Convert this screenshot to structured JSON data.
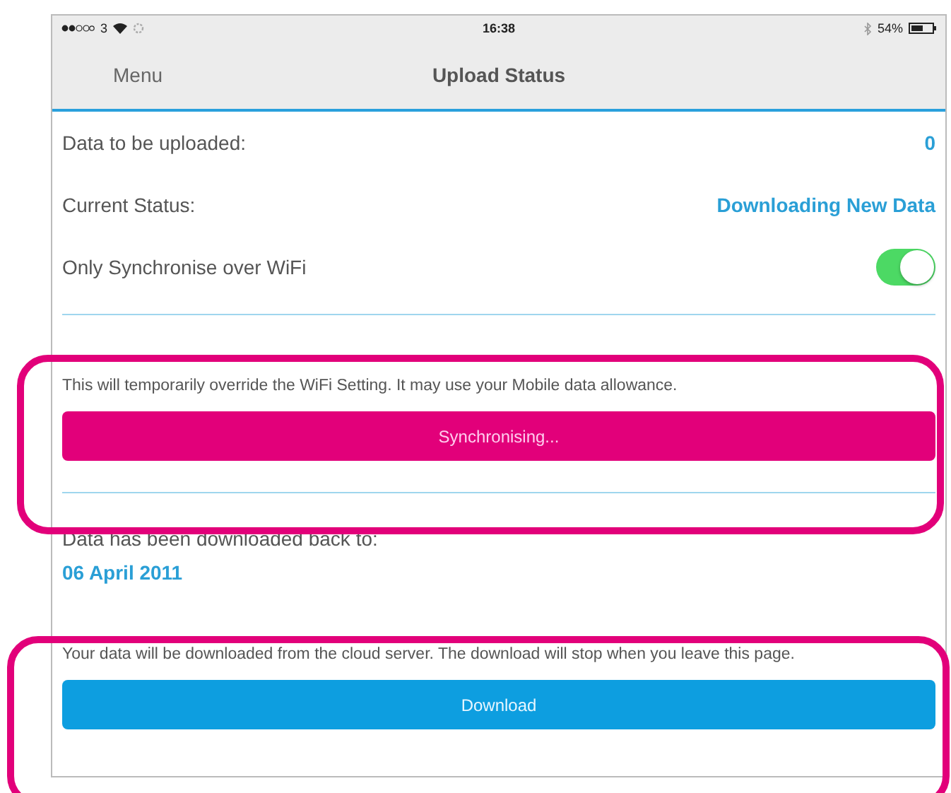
{
  "status_bar": {
    "carrier": "3",
    "time": "16:38",
    "battery": "54%"
  },
  "nav": {
    "back": "Menu",
    "title": "Upload Status"
  },
  "rows": [
    {
      "kind": "value",
      "label": "Data to be uploaded:",
      "value": "0"
    },
    {
      "kind": "value",
      "label": "Current Status:",
      "value": "Downloading New Data"
    },
    {
      "kind": "toggle",
      "label": "Only Synchronise over WiFi",
      "on": true
    }
  ],
  "sync": {
    "highlighted": true,
    "description": "This will temporarily override the WiFi Setting.  It may use your Mobile data allowance.",
    "button": "Synchronising..."
  },
  "downloaded": {
    "label": "Data has been downloaded back to:",
    "date": "06 April 2011"
  },
  "download": {
    "highlighted": true,
    "description": "Your data will be downloaded from the cloud server. The download will stop when you leave this page.",
    "button": "Download"
  }
}
